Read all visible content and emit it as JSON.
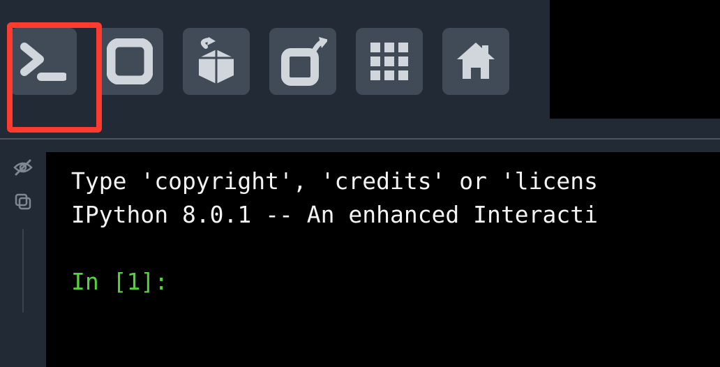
{
  "toolbar": {
    "buttons": [
      {
        "name": "console-icon"
      },
      {
        "name": "stop-icon"
      },
      {
        "name": "box-arrow-icon"
      },
      {
        "name": "square-arrow-icon"
      },
      {
        "name": "grid-icon"
      },
      {
        "name": "home-icon"
      }
    ]
  },
  "console": {
    "line1": "Type 'copyright', 'credits' or 'licens",
    "line2": "IPython 8.0.1 -- An enhanced Interacti",
    "blank": "",
    "prompt": "In [1]: "
  }
}
